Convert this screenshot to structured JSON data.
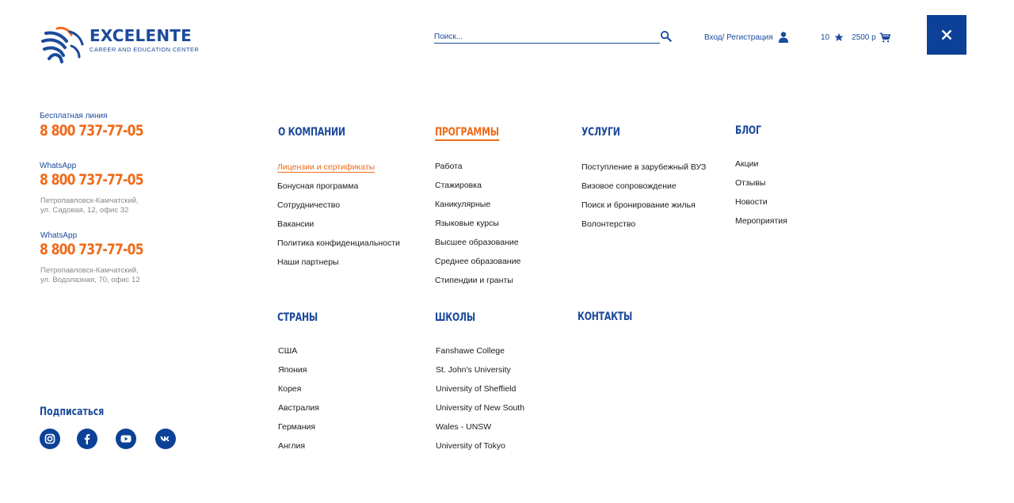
{
  "brand": {
    "title": "EXCELENTE",
    "subtitle": "CAREER AND EDUCATION CENTER"
  },
  "search": {
    "placeholder": "Поиск..."
  },
  "login": {
    "label": "Вход/ Регистрация"
  },
  "favorites": {
    "count": "10"
  },
  "cart": {
    "total": "2500 р"
  },
  "contacts": {
    "free_line_label": "Бесплатная линия",
    "free_line_phone": "8 800 737-77-05",
    "whatsapp1_label": "WhatsApp",
    "whatsapp1_phone": "8 800 737-77-05",
    "whatsapp1_addr_line1": "Петропавловск-Камчатский,",
    "whatsapp1_addr_line2": "ул. Садовая, 12, офис 32",
    "whatsapp2_label": "WhatsApp",
    "whatsapp2_phone": "8 800 737-77-05",
    "whatsapp2_addr_line1": "Петропавловск-Камчатский,",
    "whatsapp2_addr_line2": "ул. Водолазная, 70, офис 12"
  },
  "menu": {
    "company": {
      "title": "О компании",
      "items": [
        "Лицензии и сертификаты",
        "Бонусная программа",
        "Сотрудничество",
        "Вакансии",
        "Политика конфиденциальности",
        "Наши партнеры"
      ]
    },
    "programs": {
      "title": "Программы",
      "items": [
        "Работа",
        "Стажировка",
        "Каникулярные",
        "Языковые курсы",
        "Высшее образование",
        "Среднее образование",
        "Стипендии и гранты"
      ]
    },
    "services": {
      "title": "Услуги",
      "items": [
        "Поступление в зарубежный ВУЗ",
        "Визовое сопровождение",
        "Поиск и бронирование жилья",
        "Волонтерство"
      ]
    },
    "blog": {
      "title": "Блог",
      "items": [
        "Акции",
        "Отзывы",
        "Новости",
        "Мероприятия"
      ]
    },
    "countries": {
      "title": "Страны",
      "items": [
        "США",
        "Япония",
        "Корея",
        "Австралия",
        "Германия",
        "Англия"
      ]
    },
    "schools": {
      "title": "Школы",
      "items": [
        "Fanshawe College",
        "St. John's University",
        "University of Sheffield",
        "University of New South",
        "Wales - UNSW",
        "University of Tokyo"
      ]
    },
    "contacts_title": "Контакты"
  },
  "subscribe": {
    "title": "Подписаться"
  },
  "social": [
    "instagram-icon",
    "facebook-icon",
    "youtube-icon",
    "vk-icon"
  ],
  "colors": {
    "brand_blue": "#1c4a9c",
    "accent_orange": "#ef6a1a",
    "close_bg": "#0c4197"
  }
}
